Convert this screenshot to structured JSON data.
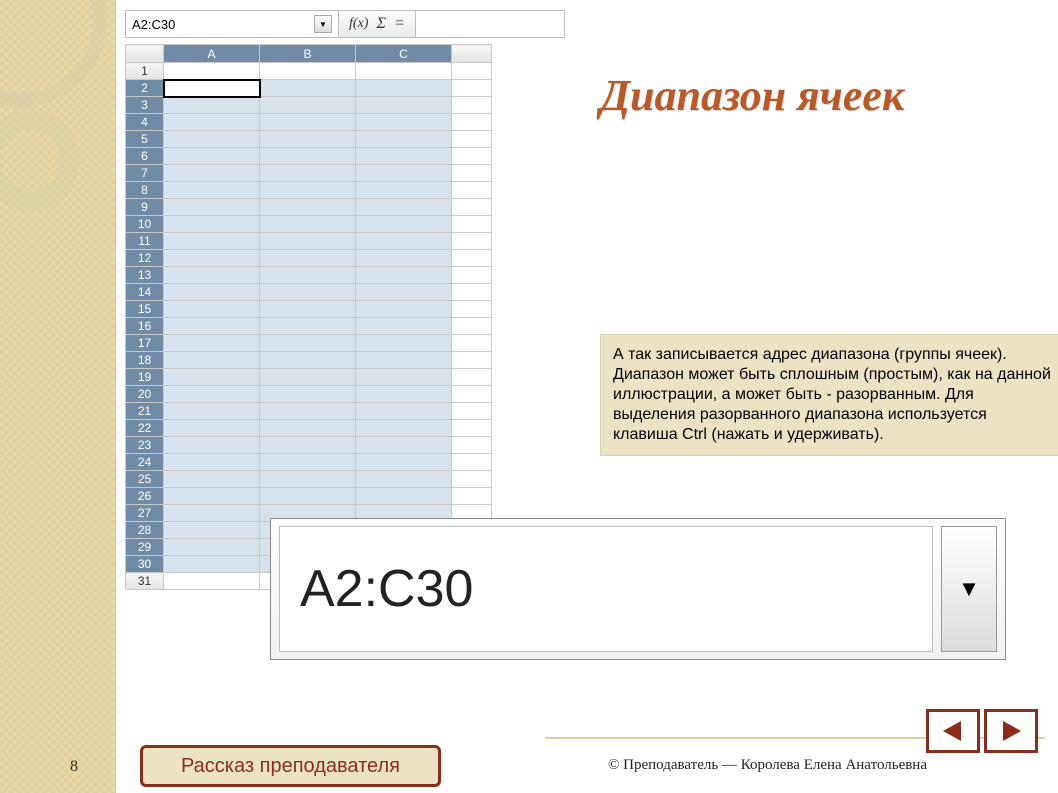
{
  "slide": {
    "title": "Диапазон ячеек",
    "page_number": "8",
    "narrative_button": "Рассказ преподавателя",
    "copyright": "© Преподаватель — Королева Елена Анатольевна",
    "explanation": "А так записывается адрес диапазона (группы ячеек). Диапазон может быть сплошным (простым), как на данной иллюстрации, а может быть - разорванным. Для выделения разорванного диапазона используется клавиша Ctrl (нажать и удерживать)."
  },
  "spreadsheet": {
    "name_box_value": "A2:C30",
    "callout_value": "A2:C30",
    "columns": [
      "A",
      "B",
      "C"
    ],
    "selected_columns": [
      "A",
      "B",
      "C"
    ],
    "row_count": 31,
    "selected_rows_from": 2,
    "selected_rows_to": 30,
    "active_cell": "A2",
    "fbar_icons": {
      "fx": "f(x)",
      "sigma": "Σ",
      "eq": "="
    }
  },
  "nav": {
    "prev": "previous",
    "next": "next"
  }
}
